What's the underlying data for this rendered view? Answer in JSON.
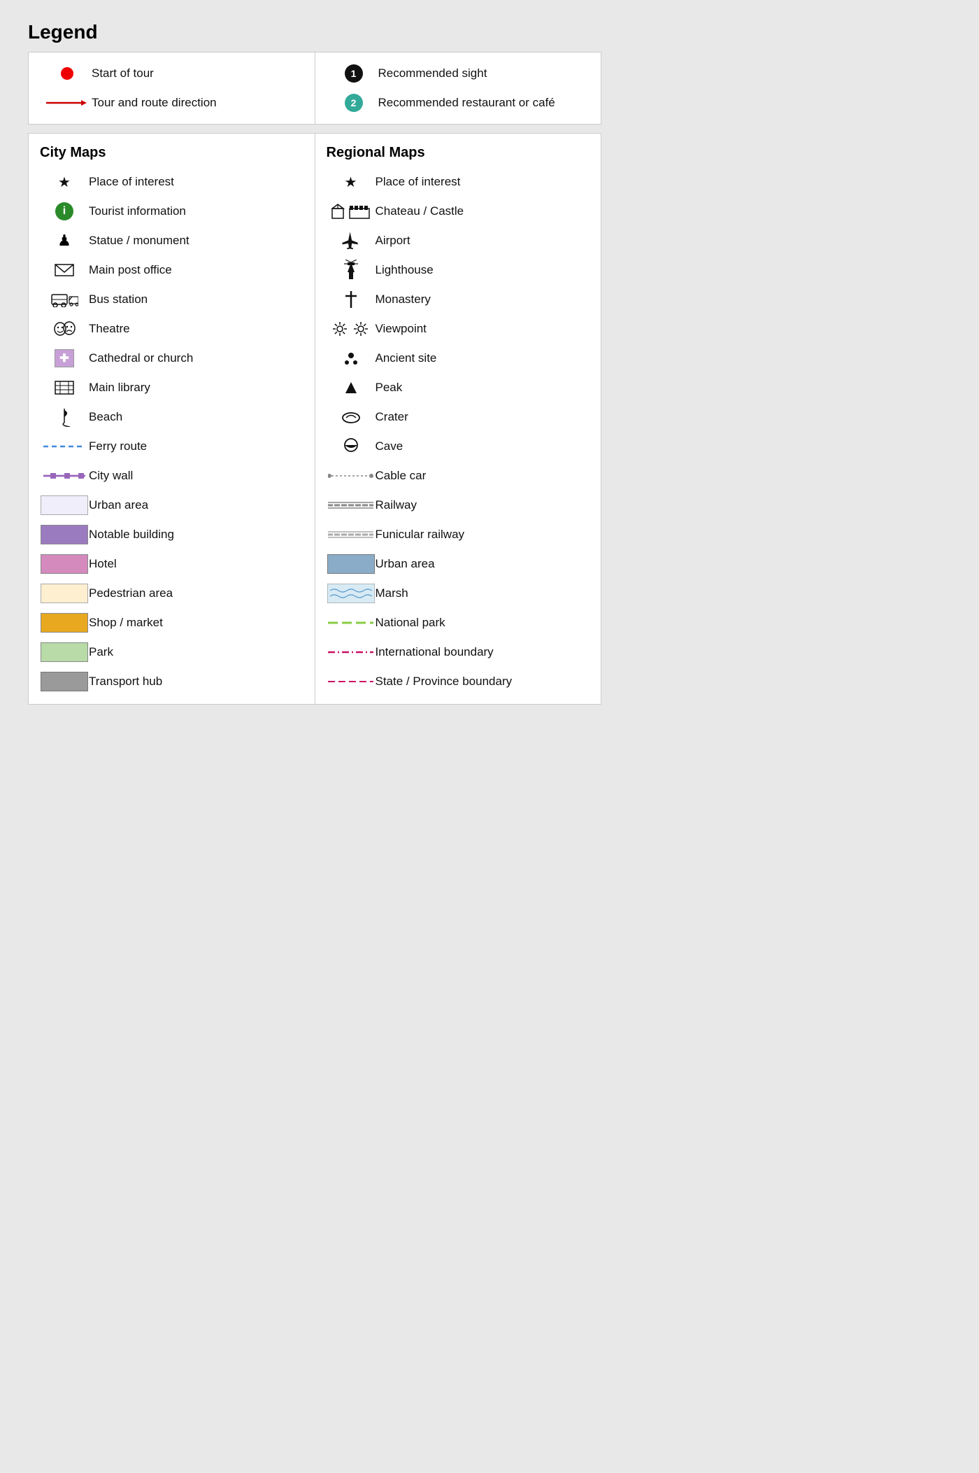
{
  "title": "Legend",
  "top_section": {
    "left": [
      {
        "icon_type": "red-dot",
        "label": "Start of tour"
      },
      {
        "icon_type": "red-arrow",
        "label": "Tour and route direction"
      }
    ],
    "right": [
      {
        "icon_type": "black-num",
        "num": "1",
        "label": "Recommended sight"
      },
      {
        "icon_type": "green-num",
        "num": "2",
        "label": "Recommended restaurant or café"
      }
    ]
  },
  "city_maps": {
    "title": "City Maps",
    "items": [
      {
        "icon_type": "star",
        "label": "Place of interest"
      },
      {
        "icon_type": "green-info",
        "label": "Tourist information"
      },
      {
        "icon_type": "chess",
        "label": "Statue / monument"
      },
      {
        "icon_type": "envelope",
        "label": "Main post office"
      },
      {
        "icon_type": "bus",
        "label": "Bus station"
      },
      {
        "icon_type": "theatre",
        "label": "Theatre"
      },
      {
        "icon_type": "church-box",
        "label": "Cathedral or church"
      },
      {
        "icon_type": "library",
        "label": "Main library"
      },
      {
        "icon_type": "beach",
        "label": "Beach"
      },
      {
        "icon_type": "ferry-line",
        "label": "Ferry route"
      },
      {
        "icon_type": "city-wall",
        "label": "City wall"
      },
      {
        "icon_type": "urban-box",
        "color": "#f0eefa",
        "label": "Urban area"
      },
      {
        "icon_type": "color-box",
        "color": "#9b7bc0",
        "label": "Notable building"
      },
      {
        "icon_type": "color-box",
        "color": "#d48abd",
        "label": "Hotel"
      },
      {
        "icon_type": "color-box",
        "color": "#fdefd0",
        "label": "Pedestrian area"
      },
      {
        "icon_type": "color-box",
        "color": "#e8a820",
        "label": "Shop / market"
      },
      {
        "icon_type": "color-box",
        "color": "#b8dba8",
        "label": "Park"
      },
      {
        "icon_type": "color-box",
        "color": "#9a9a9a",
        "label": "Transport hub"
      }
    ]
  },
  "regional_maps": {
    "title": "Regional Maps",
    "items": [
      {
        "icon_type": "star",
        "label": "Place of interest"
      },
      {
        "icon_type": "castle",
        "label": "Chateau / Castle"
      },
      {
        "icon_type": "airport",
        "label": "Airport"
      },
      {
        "icon_type": "lighthouse",
        "label": "Lighthouse"
      },
      {
        "icon_type": "cross",
        "label": "Monastery"
      },
      {
        "icon_type": "viewpoint",
        "label": "Viewpoint"
      },
      {
        "icon_type": "ancient",
        "label": "Ancient site"
      },
      {
        "icon_type": "peak",
        "label": "Peak"
      },
      {
        "icon_type": "crater",
        "label": "Crater"
      },
      {
        "icon_type": "cave",
        "label": "Cave"
      },
      {
        "icon_type": "cable-car",
        "label": "Cable car"
      },
      {
        "icon_type": "railway",
        "label": "Railway"
      },
      {
        "icon_type": "funicular",
        "label": "Funicular railway"
      },
      {
        "icon_type": "color-box",
        "color": "#8aacc8",
        "label": "Urban area"
      },
      {
        "icon_type": "marsh-box",
        "label": "Marsh"
      },
      {
        "icon_type": "national-park-line",
        "label": "National park"
      },
      {
        "icon_type": "intl-boundary",
        "label": "International boundary"
      },
      {
        "icon_type": "state-boundary",
        "label": "State / Province boundary"
      }
    ]
  }
}
